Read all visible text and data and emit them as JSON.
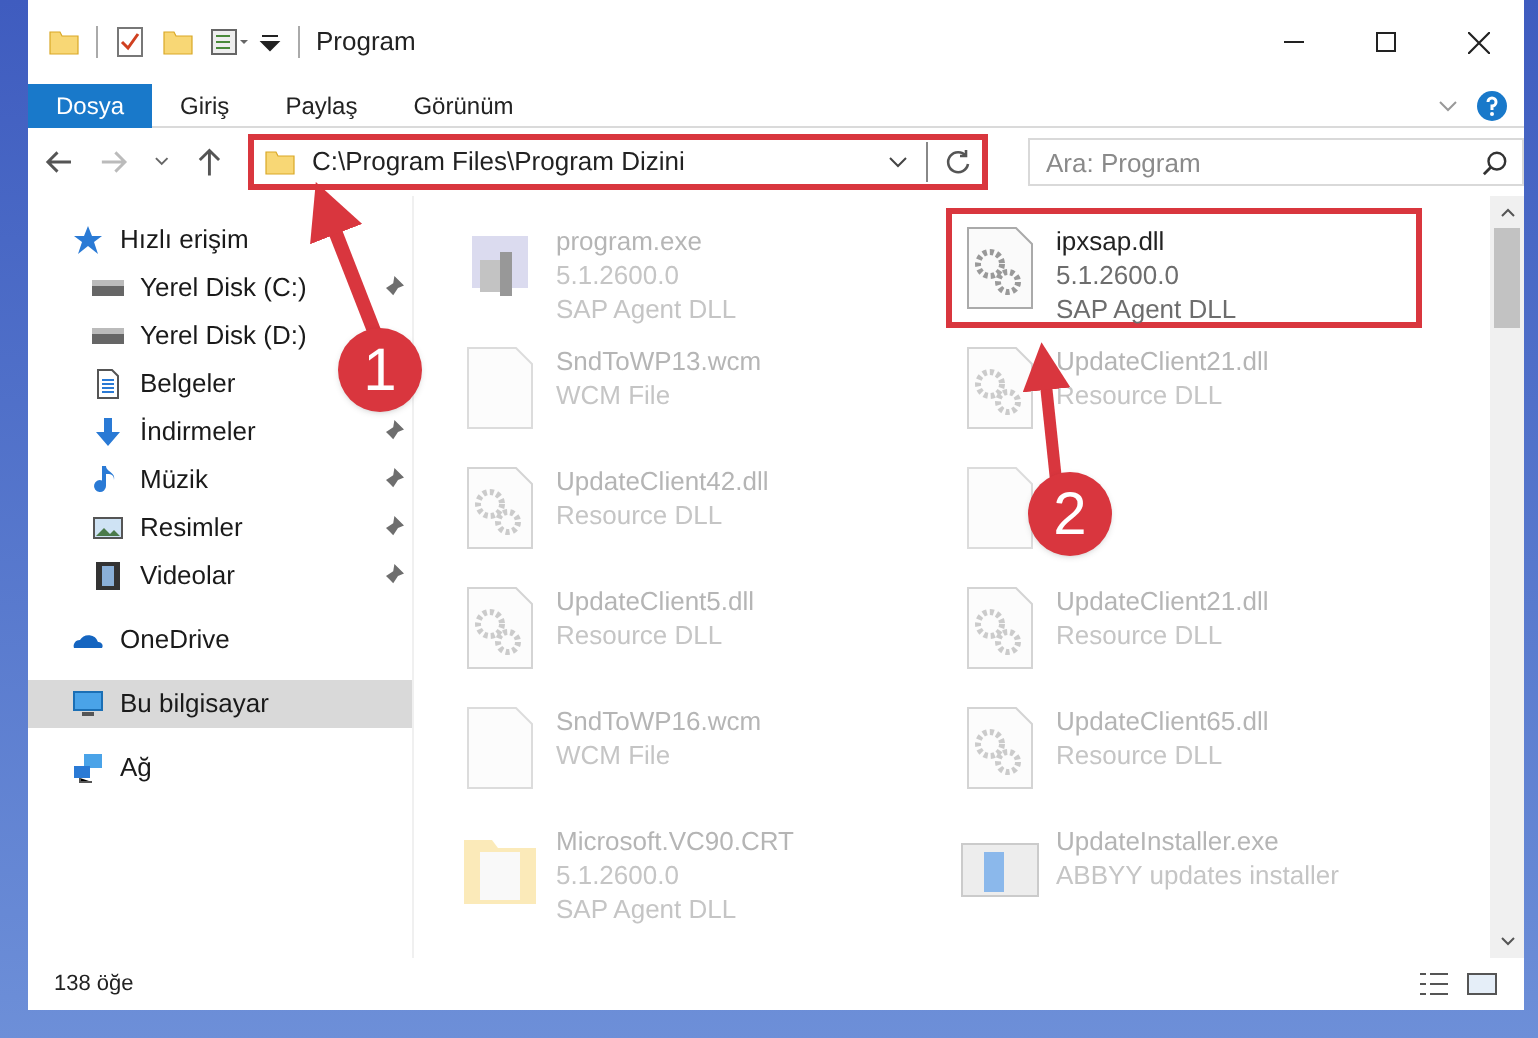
{
  "window": {
    "title": "Program"
  },
  "ribbon_tabs": [
    {
      "label": "Dosya",
      "selected": true
    },
    {
      "label": "Giriş",
      "selected": false
    },
    {
      "label": "Paylaş",
      "selected": false
    },
    {
      "label": "Görünüm",
      "selected": false
    }
  ],
  "address_bar": {
    "path": "C:\\Program Files\\Program Dizini",
    "highlighted": true
  },
  "search": {
    "placeholder": "Ara: Program"
  },
  "sidebar": {
    "items": [
      {
        "label": "Hızlı erişim",
        "kind": "star",
        "selected": false,
        "children": [
          {
            "label": "Yerel Disk (C:)",
            "kind": "drive",
            "pinned": true,
            "selected": false
          },
          {
            "label": "Yerel Disk (D:)",
            "kind": "drive",
            "pinned": false,
            "selected": false
          },
          {
            "label": "Belgeler",
            "kind": "documents",
            "pinned": false,
            "selected": false
          },
          {
            "label": "İndirmeler",
            "kind": "downloads",
            "pinned": true,
            "selected": false
          },
          {
            "label": "Müzik",
            "kind": "music",
            "pinned": true,
            "selected": false
          },
          {
            "label": "Resimler",
            "kind": "pictures",
            "pinned": true,
            "selected": false
          },
          {
            "label": "Videolar",
            "kind": "videos",
            "pinned": true,
            "selected": false
          }
        ]
      },
      {
        "label": "OneDrive",
        "kind": "cloud",
        "selected": false
      },
      {
        "label": "Bu bilgisayar",
        "kind": "computer",
        "selected": true
      },
      {
        "label": "Ağ",
        "kind": "network",
        "selected": false
      }
    ]
  },
  "files": [
    {
      "name": "program.exe",
      "lines": [
        "5.1.2600.0",
        "SAP Agent DLL"
      ],
      "kind": "exe",
      "faded": true,
      "highlighted": false
    },
    {
      "name": "ipxsap.dll",
      "lines": [
        "5.1.2600.0",
        "SAP Agent DLL"
      ],
      "kind": "dll",
      "faded": false,
      "highlighted": true
    },
    {
      "name": "SndToWP13.wcm",
      "lines": [
        "WCM File"
      ],
      "kind": "blank",
      "faded": true,
      "highlighted": false
    },
    {
      "name": "UpdateClient21.dll",
      "lines": [
        "Resource DLL"
      ],
      "kind": "dll",
      "faded": true,
      "highlighted": false
    },
    {
      "name": "UpdateClient42.dll",
      "lines": [
        "Resource DLL"
      ],
      "kind": "dll",
      "faded": true,
      "highlighted": false
    },
    {
      "kind": "blank",
      "faded": true,
      "highlighted": false
    },
    {
      "name": "UpdateClient5.dll",
      "lines": [
        "Resource DLL"
      ],
      "kind": "dll",
      "faded": true,
      "highlighted": false
    },
    {
      "name": "UpdateClient21.dll",
      "lines": [
        "Resource DLL"
      ],
      "kind": "dll",
      "faded": true,
      "highlighted": false
    },
    {
      "name": "SndToWP16.wcm",
      "lines": [
        "WCM File"
      ],
      "kind": "blank",
      "faded": true,
      "highlighted": false
    },
    {
      "name": "UpdateClient65.dll",
      "lines": [
        "Resource DLL"
      ],
      "kind": "dll",
      "faded": true,
      "highlighted": false
    },
    {
      "name": "Microsoft.VC90.CRT",
      "lines": [
        "5.1.2600.0",
        "SAP Agent DLL"
      ],
      "kind": "folder",
      "faded": true,
      "highlighted": false
    },
    {
      "name": "UpdateInstaller.exe",
      "lines": [
        "ABBYY updates installer"
      ],
      "kind": "installer",
      "faded": true,
      "highlighted": false
    }
  ],
  "status_bar": {
    "item_count": "138 öğe"
  },
  "annotations": [
    {
      "number": "1"
    },
    {
      "number": "2"
    }
  ]
}
